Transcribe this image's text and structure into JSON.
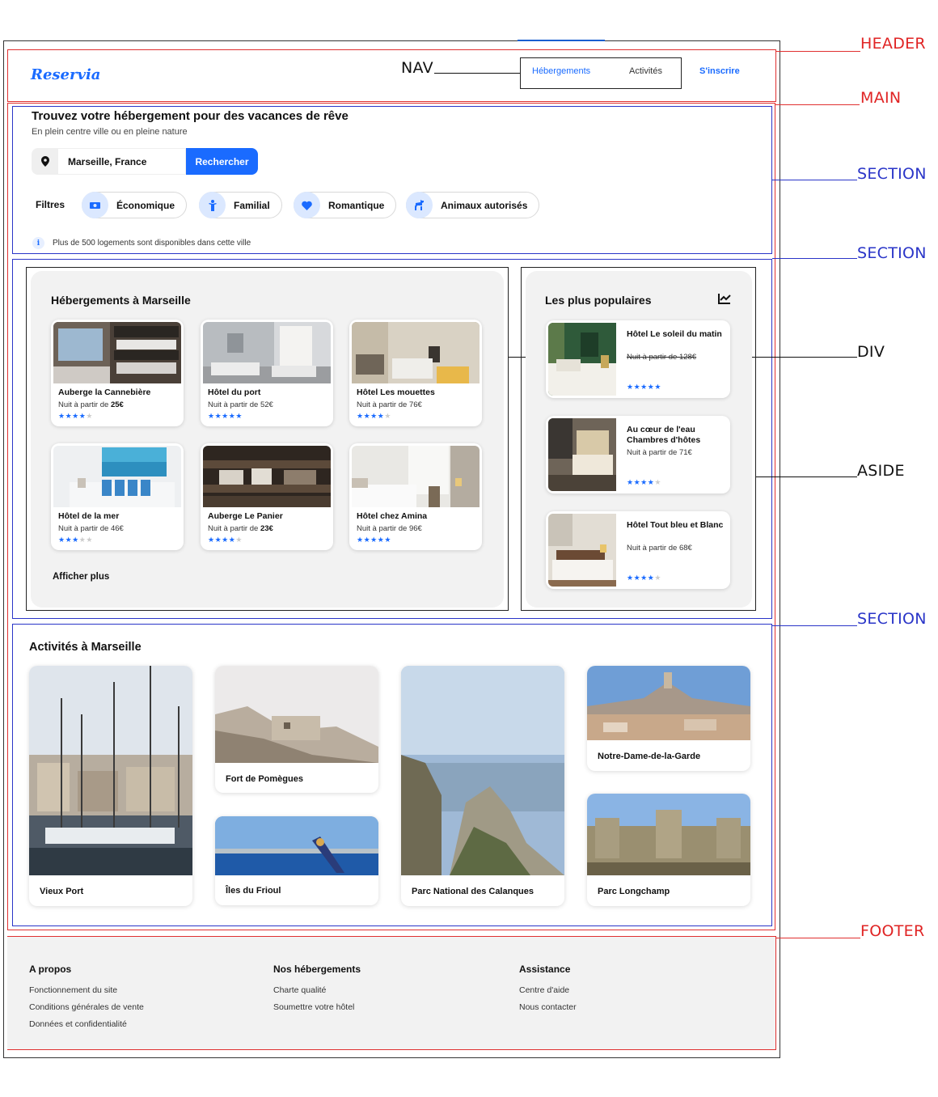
{
  "colors": {
    "accent": "#1a6bff",
    "annotation_red": "#e02424",
    "annotation_blue": "#2a35c8",
    "panel_bg": "#f2f2f2"
  },
  "annotations": {
    "header": "HEADER",
    "nav": "NAV",
    "main": "MAIN",
    "section1": "SECTION",
    "section2": "SECTION",
    "div": "DIV",
    "aside": "ASIDE",
    "section3": "SECTION",
    "footer": "FOOTER"
  },
  "header": {
    "logo": "Reservia",
    "nav": {
      "accommodations": "Hébergements",
      "activities": "Activités"
    },
    "signup": "S'inscrire"
  },
  "hero": {
    "title": "Trouvez votre hébergement pour des vacances de rêve",
    "subtitle": "En plein centre ville ou en pleine nature",
    "search": {
      "icon": "map-pin-icon",
      "value": "Marseille, France",
      "button": "Rechercher"
    },
    "filters_label": "Filtres",
    "filters": [
      {
        "label": "Économique",
        "icon": "money-icon"
      },
      {
        "label": "Familial",
        "icon": "family-icon"
      },
      {
        "label": "Romantique",
        "icon": "heart-icon"
      },
      {
        "label": "Animaux autorisés",
        "icon": "dog-icon"
      }
    ],
    "info": "Plus de 500 logements sont disponibles dans cette ville"
  },
  "listings": {
    "title": "Hébergements à Marseille",
    "items": [
      {
        "name": "Auberge la Cannebière",
        "price_prefix": "Nuit à partir de ",
        "price": "25€",
        "price_bold": true,
        "stars": 4
      },
      {
        "name": "Hôtel du port",
        "price_prefix": "Nuit à partir de ",
        "price": "52€",
        "price_bold": false,
        "stars": 5
      },
      {
        "name": "Hôtel Les mouettes",
        "price_prefix": "Nuit à partir de ",
        "price": "76€",
        "price_bold": false,
        "stars": 4
      },
      {
        "name": "Hôtel de la mer",
        "price_prefix": "Nuit à partir de ",
        "price": "46€",
        "price_bold": false,
        "stars": 3
      },
      {
        "name": "Auberge Le Panier",
        "price_prefix": "Nuit à partir de ",
        "price": "23€",
        "price_bold": true,
        "stars": 4
      },
      {
        "name": "Hôtel chez Amina",
        "price_prefix": "Nuit à partir de ",
        "price": "96€",
        "price_bold": false,
        "stars": 5
      }
    ],
    "more": "Afficher plus"
  },
  "popular": {
    "title": "Les plus populaires",
    "icon": "trending-chart-icon",
    "items": [
      {
        "name": "Hôtel Le soleil du matin",
        "price": "Nuit à partir de 128€",
        "stars": 5
      },
      {
        "name": "Au cœur de l'eau Chambres d'hôtes",
        "price": "Nuit à partir de 71€",
        "stars": 4
      },
      {
        "name": "Hôtel Tout bleu et Blanc",
        "price": "Nuit à partir de 68€",
        "stars": 4
      }
    ]
  },
  "activities": {
    "title": "Activités à Marseille",
    "items": [
      "Vieux Port",
      "Fort de Pomègues",
      "Îles du Frioul",
      "Parc National des Calanques",
      "Notre-Dame-de-la-Garde",
      "Parc Longchamp"
    ]
  },
  "footer": {
    "columns": [
      {
        "title": "A propos",
        "links": [
          "Fonctionnement du site",
          "Conditions générales de vente",
          "Données et confidentialité"
        ]
      },
      {
        "title": "Nos hébergements",
        "links": [
          "Charte qualité",
          "Soumettre votre hôtel"
        ]
      },
      {
        "title": "Assistance",
        "links": [
          "Centre d'aide",
          "Nous contacter"
        ]
      }
    ]
  }
}
